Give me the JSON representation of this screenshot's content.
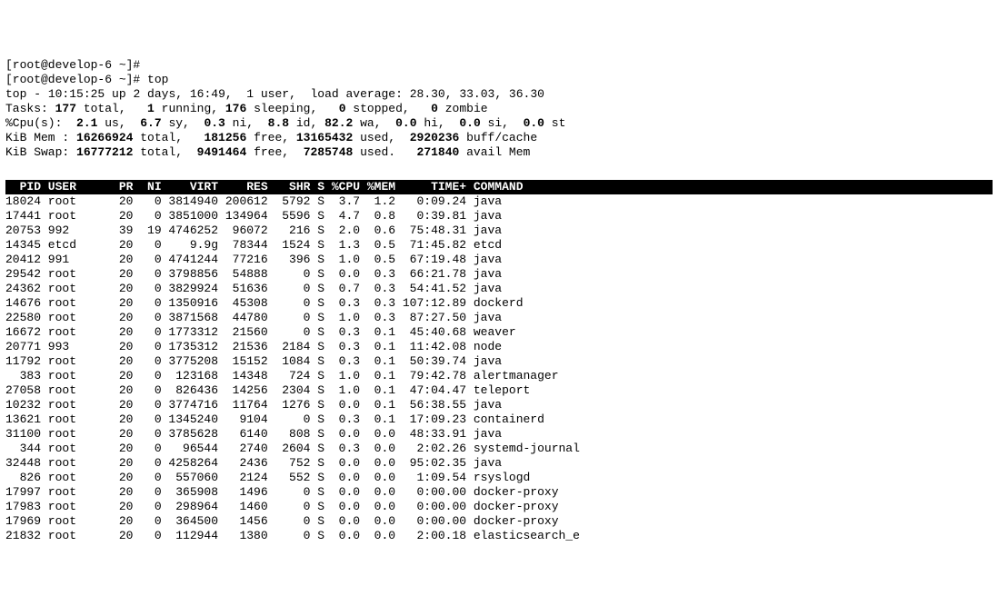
{
  "prompt_lines": [
    "[root@develop-6 ~]#",
    "[root@develop-6 ~]# top"
  ],
  "summary": {
    "l1": {
      "prefix": "top - ",
      "time": "10:15:25",
      "up_label": " up ",
      "up": "2 days, 16:49,",
      "users": "  1 user,",
      "load_label": "  load average: ",
      "load": "28.30, 33.03, 36.30"
    },
    "l2": {
      "label": "Tasks:",
      "total": "177",
      "total_lbl": " total,",
      "running": "1",
      "running_lbl": " running,",
      "sleeping": "176",
      "sleeping_lbl": " sleeping,",
      "stopped": "0",
      "stopped_lbl": " stopped,",
      "zombie": "0",
      "zombie_lbl": " zombie"
    },
    "l3": {
      "label": "%Cpu(s):",
      "us": "2.1",
      "us_lbl": " us,",
      "sy": "6.7",
      "sy_lbl": " sy,",
      "ni": "0.3",
      "ni_lbl": " ni,",
      "id": "8.8",
      "id_lbl": " id,",
      "wa": "82.2",
      "wa_lbl": " wa,",
      "hi": "0.0",
      "hi_lbl": " hi,",
      "si": "0.0",
      "si_lbl": " si,",
      "st": "0.0",
      "st_lbl": " st"
    },
    "l4": {
      "label": "KiB Mem :",
      "total": "16266924",
      "total_lbl": " total,",
      "free": "181256",
      "free_lbl": " free,",
      "used": "13165432",
      "used_lbl": " used,",
      "buff": "2920236",
      "buff_lbl": " buff/cache"
    },
    "l5": {
      "label": "KiB Swap:",
      "total": "16777212",
      "total_lbl": " total,",
      "free": "9491464",
      "free_lbl": " free,",
      "used": "7285748",
      "used_lbl": " used.",
      "avail": "271840",
      "avail_lbl": " avail Mem"
    }
  },
  "columns": [
    "PID",
    "USER",
    "PR",
    "NI",
    "VIRT",
    "RES",
    "SHR",
    "S",
    "%CPU",
    "%MEM",
    "TIME+",
    "COMMAND"
  ],
  "col_widths": {
    "pid": 5,
    "user": 9,
    "pr": 4,
    "ni": 4,
    "virt": 8,
    "res": 7,
    "shr": 6,
    "s": 2,
    "cpu": 5,
    "mem": 5,
    "time": 10,
    "cmd": 20
  },
  "processes": [
    {
      "pid": "18024",
      "user": "root",
      "pr": "20",
      "ni": "0",
      "virt": "3814940",
      "res": "200612",
      "shr": "5792",
      "s": "S",
      "cpu": "3.7",
      "mem": "1.2",
      "time": "0:09.24",
      "cmd": "java"
    },
    {
      "pid": "17441",
      "user": "root",
      "pr": "20",
      "ni": "0",
      "virt": "3851000",
      "res": "134964",
      "shr": "5596",
      "s": "S",
      "cpu": "4.7",
      "mem": "0.8",
      "time": "0:39.81",
      "cmd": "java"
    },
    {
      "pid": "20753",
      "user": "992",
      "pr": "39",
      "ni": "19",
      "virt": "4746252",
      "res": "96072",
      "shr": "216",
      "s": "S",
      "cpu": "2.0",
      "mem": "0.6",
      "time": "75:48.31",
      "cmd": "java"
    },
    {
      "pid": "14345",
      "user": "etcd",
      "pr": "20",
      "ni": "0",
      "virt": "9.9g",
      "res": "78344",
      "shr": "1524",
      "s": "S",
      "cpu": "1.3",
      "mem": "0.5",
      "time": "71:45.82",
      "cmd": "etcd"
    },
    {
      "pid": "20412",
      "user": "991",
      "pr": "20",
      "ni": "0",
      "virt": "4741244",
      "res": "77216",
      "shr": "396",
      "s": "S",
      "cpu": "1.0",
      "mem": "0.5",
      "time": "67:19.48",
      "cmd": "java"
    },
    {
      "pid": "29542",
      "user": "root",
      "pr": "20",
      "ni": "0",
      "virt": "3798856",
      "res": "54888",
      "shr": "0",
      "s": "S",
      "cpu": "0.0",
      "mem": "0.3",
      "time": "66:21.78",
      "cmd": "java"
    },
    {
      "pid": "24362",
      "user": "root",
      "pr": "20",
      "ni": "0",
      "virt": "3829924",
      "res": "51636",
      "shr": "0",
      "s": "S",
      "cpu": "0.7",
      "mem": "0.3",
      "time": "54:41.52",
      "cmd": "java"
    },
    {
      "pid": "14676",
      "user": "root",
      "pr": "20",
      "ni": "0",
      "virt": "1350916",
      "res": "45308",
      "shr": "0",
      "s": "S",
      "cpu": "0.3",
      "mem": "0.3",
      "time": "107:12.89",
      "cmd": "dockerd"
    },
    {
      "pid": "22580",
      "user": "root",
      "pr": "20",
      "ni": "0",
      "virt": "3871568",
      "res": "44780",
      "shr": "0",
      "s": "S",
      "cpu": "1.0",
      "mem": "0.3",
      "time": "87:27.50",
      "cmd": "java"
    },
    {
      "pid": "16672",
      "user": "root",
      "pr": "20",
      "ni": "0",
      "virt": "1773312",
      "res": "21560",
      "shr": "0",
      "s": "S",
      "cpu": "0.3",
      "mem": "0.1",
      "time": "45:40.68",
      "cmd": "weaver"
    },
    {
      "pid": "20771",
      "user": "993",
      "pr": "20",
      "ni": "0",
      "virt": "1735312",
      "res": "21536",
      "shr": "2184",
      "s": "S",
      "cpu": "0.3",
      "mem": "0.1",
      "time": "11:42.08",
      "cmd": "node"
    },
    {
      "pid": "11792",
      "user": "root",
      "pr": "20",
      "ni": "0",
      "virt": "3775208",
      "res": "15152",
      "shr": "1084",
      "s": "S",
      "cpu": "0.3",
      "mem": "0.1",
      "time": "50:39.74",
      "cmd": "java"
    },
    {
      "pid": "383",
      "user": "root",
      "pr": "20",
      "ni": "0",
      "virt": "123168",
      "res": "14348",
      "shr": "724",
      "s": "S",
      "cpu": "1.0",
      "mem": "0.1",
      "time": "79:42.78",
      "cmd": "alertmanager"
    },
    {
      "pid": "27058",
      "user": "root",
      "pr": "20",
      "ni": "0",
      "virt": "826436",
      "res": "14256",
      "shr": "2304",
      "s": "S",
      "cpu": "1.0",
      "mem": "0.1",
      "time": "47:04.47",
      "cmd": "teleport"
    },
    {
      "pid": "10232",
      "user": "root",
      "pr": "20",
      "ni": "0",
      "virt": "3774716",
      "res": "11764",
      "shr": "1276",
      "s": "S",
      "cpu": "0.0",
      "mem": "0.1",
      "time": "56:38.55",
      "cmd": "java"
    },
    {
      "pid": "13621",
      "user": "root",
      "pr": "20",
      "ni": "0",
      "virt": "1345240",
      "res": "9104",
      "shr": "0",
      "s": "S",
      "cpu": "0.3",
      "mem": "0.1",
      "time": "17:09.23",
      "cmd": "containerd"
    },
    {
      "pid": "31100",
      "user": "root",
      "pr": "20",
      "ni": "0",
      "virt": "3785628",
      "res": "6140",
      "shr": "808",
      "s": "S",
      "cpu": "0.0",
      "mem": "0.0",
      "time": "48:33.91",
      "cmd": "java"
    },
    {
      "pid": "344",
      "user": "root",
      "pr": "20",
      "ni": "0",
      "virt": "96544",
      "res": "2740",
      "shr": "2604",
      "s": "S",
      "cpu": "0.3",
      "mem": "0.0",
      "time": "2:02.26",
      "cmd": "systemd-journal"
    },
    {
      "pid": "32448",
      "user": "root",
      "pr": "20",
      "ni": "0",
      "virt": "4258264",
      "res": "2436",
      "shr": "752",
      "s": "S",
      "cpu": "0.0",
      "mem": "0.0",
      "time": "95:02.35",
      "cmd": "java"
    },
    {
      "pid": "826",
      "user": "root",
      "pr": "20",
      "ni": "0",
      "virt": "557060",
      "res": "2124",
      "shr": "552",
      "s": "S",
      "cpu": "0.0",
      "mem": "0.0",
      "time": "1:09.54",
      "cmd": "rsyslogd"
    },
    {
      "pid": "17997",
      "user": "root",
      "pr": "20",
      "ni": "0",
      "virt": "365908",
      "res": "1496",
      "shr": "0",
      "s": "S",
      "cpu": "0.0",
      "mem": "0.0",
      "time": "0:00.00",
      "cmd": "docker-proxy"
    },
    {
      "pid": "17983",
      "user": "root",
      "pr": "20",
      "ni": "0",
      "virt": "298964",
      "res": "1460",
      "shr": "0",
      "s": "S",
      "cpu": "0.0",
      "mem": "0.0",
      "time": "0:00.00",
      "cmd": "docker-proxy"
    },
    {
      "pid": "17969",
      "user": "root",
      "pr": "20",
      "ni": "0",
      "virt": "364500",
      "res": "1456",
      "shr": "0",
      "s": "S",
      "cpu": "0.0",
      "mem": "0.0",
      "time": "0:00.00",
      "cmd": "docker-proxy"
    },
    {
      "pid": "21832",
      "user": "root",
      "pr": "20",
      "ni": "0",
      "virt": "112944",
      "res": "1380",
      "shr": "0",
      "s": "S",
      "cpu": "0.0",
      "mem": "0.0",
      "time": "2:00.18",
      "cmd": "elasticsearch_e"
    }
  ]
}
